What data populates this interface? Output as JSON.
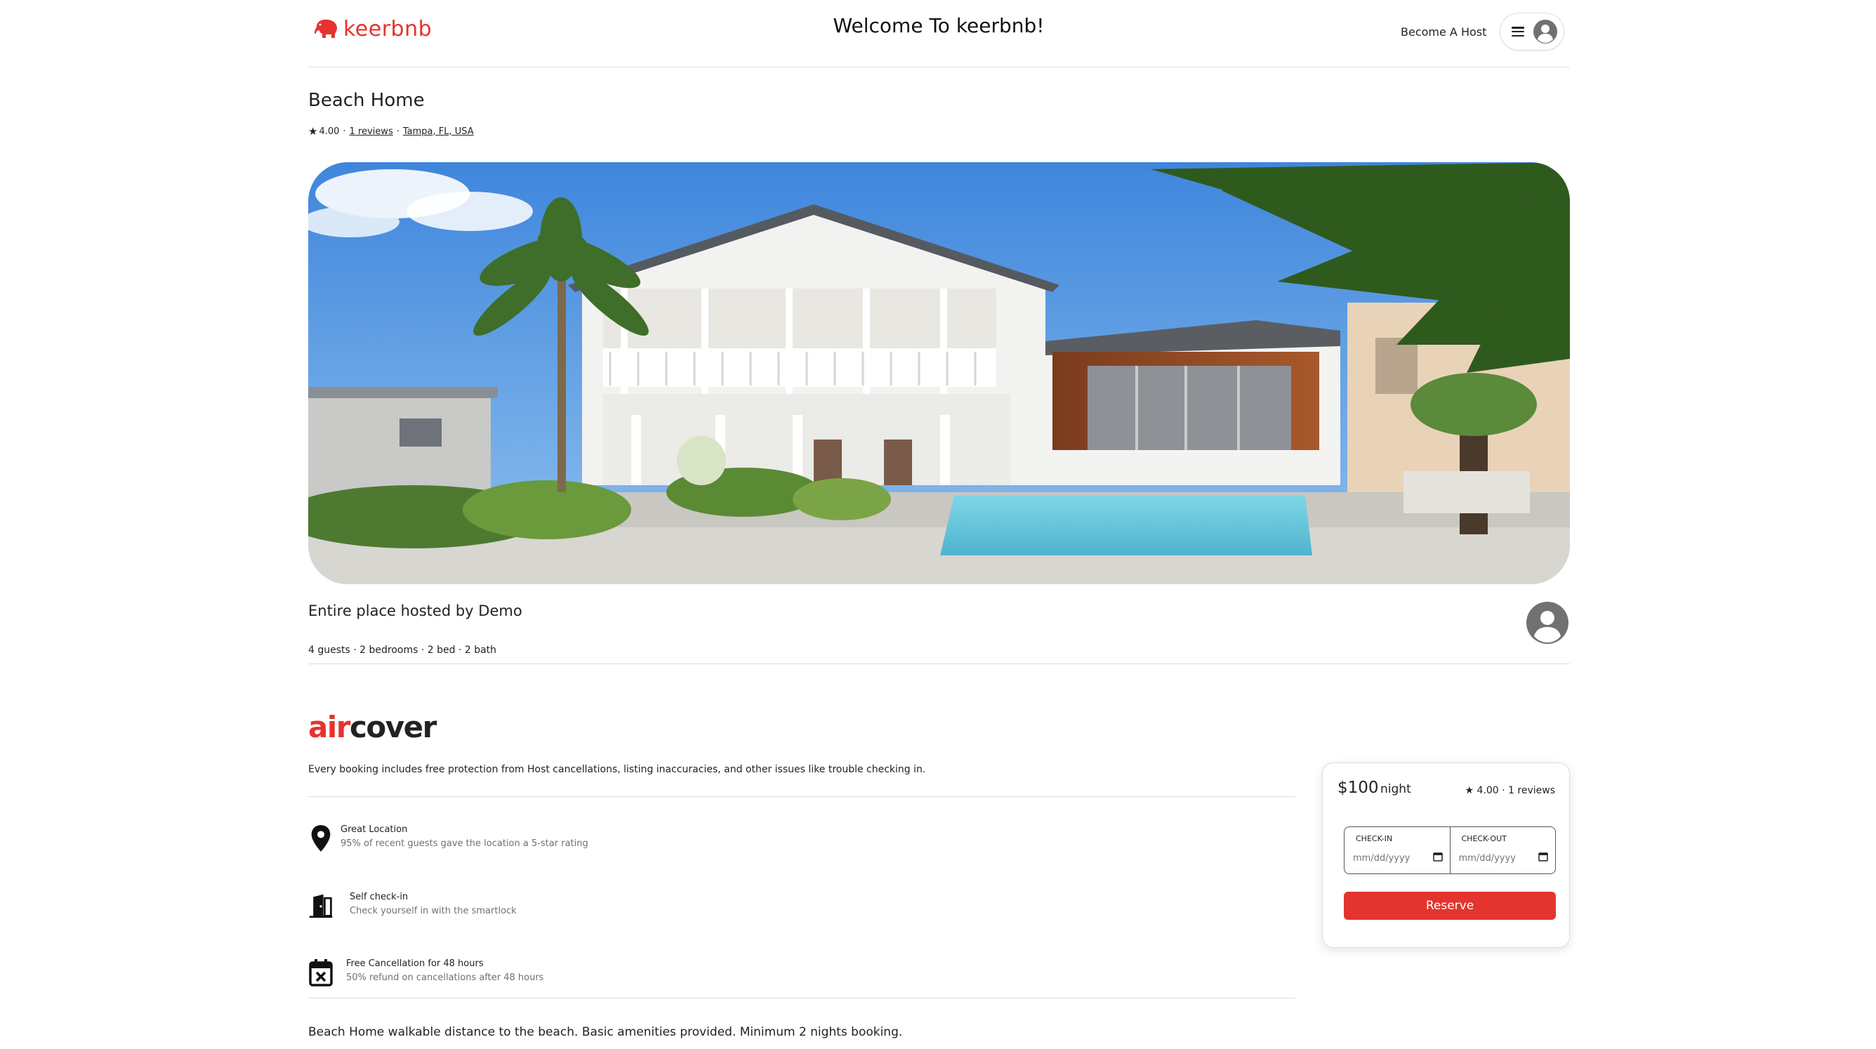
{
  "header": {
    "brand": "keerbnb",
    "welcome": "Welcome To keerbnb!",
    "become_host": "Become A Host",
    "menu_icon": "hamburger-icon",
    "avatar_icon": "user-avatar-icon"
  },
  "listing": {
    "title": "Beach Home",
    "rating": "4.00",
    "reviews_link": "1 reviews",
    "location_link": "Tampa, FL, USA",
    "hosted_by": "Entire place hosted by Demo",
    "specs": "4 guests · 2 bedrooms · 2 bed · 2 bath",
    "description": "Beach Home walkable distance to the beach. Basic amenities provided. Minimum 2 nights booking."
  },
  "aircover": {
    "brand_part1": "air",
    "brand_part2": "cover",
    "description": "Every booking includes free protection from Host cancellations, listing inaccuracies, and other issues like trouble checking in."
  },
  "features": [
    {
      "icon": "location-pin-icon",
      "title": "Great Location",
      "desc": "95% of recent guests gave the location a 5-star rating"
    },
    {
      "icon": "door-icon",
      "title": "Self check-in",
      "desc": "Check yourself in with the smartlock"
    },
    {
      "icon": "calendar-cancel-icon",
      "title": "Free Cancellation for 48 hours",
      "desc": "50% refund on cancellations after 48 hours"
    }
  ],
  "booking": {
    "price": "$100",
    "per": "night",
    "rating_summary": "4.00 · 1 reviews",
    "checkin_label": "CHECK-IN",
    "checkout_label": "CHECK-OUT",
    "date_placeholder": "mm/dd/yyyy",
    "reserve_label": "Reserve"
  },
  "colors": {
    "brand": "#e7322f",
    "divider": "#dddddd",
    "muted_text": "#717171"
  }
}
